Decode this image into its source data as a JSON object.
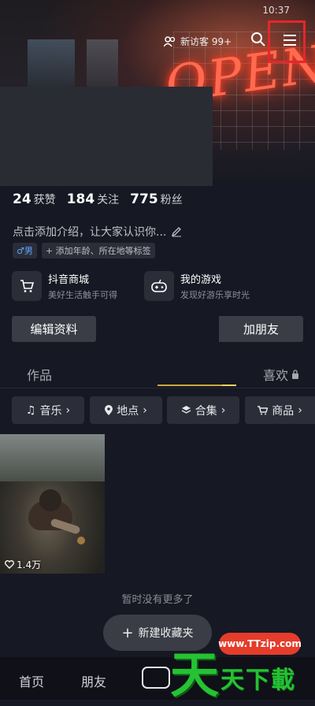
{
  "status": {
    "time": "10:37"
  },
  "header": {
    "visitors_label": "新访客 99+"
  },
  "stats": [
    {
      "num": "24",
      "label": "获赞"
    },
    {
      "num": "184",
      "label": "关注"
    },
    {
      "num": "775",
      "label": "粉丝"
    }
  ],
  "bio": {
    "text": "点击添加介绍，让大家认识你..."
  },
  "tags": {
    "gender": "♂男",
    "add": "+ 添加年龄、所在地等标签"
  },
  "cards": [
    {
      "title": "抖音商城",
      "sub": "美好生活触手可得"
    },
    {
      "title": "我的游戏",
      "sub": "发现好游乐享时光"
    }
  ],
  "buttons": {
    "edit_profile": "编辑资料",
    "add_friend": "加朋友"
  },
  "tabs": {
    "works": "作品",
    "likes": "喜欢"
  },
  "chips": [
    {
      "label": "音乐",
      "icon": "music-note-icon"
    },
    {
      "label": "地点",
      "icon": "location-pin-icon"
    },
    {
      "label": "合集",
      "icon": "layers-icon"
    },
    {
      "label": "商品",
      "icon": "cart-icon"
    }
  ],
  "video": {
    "likes": "1.4万"
  },
  "list": {
    "no_more": "暂时没有更多了"
  },
  "new_favorite": {
    "label": "新建收藏夹"
  },
  "bottom_nav": {
    "home": "首页",
    "friends": "朋友"
  },
  "watermark": {
    "url": "www.TTzip.com",
    "big": "天",
    "text": "天下載"
  }
}
